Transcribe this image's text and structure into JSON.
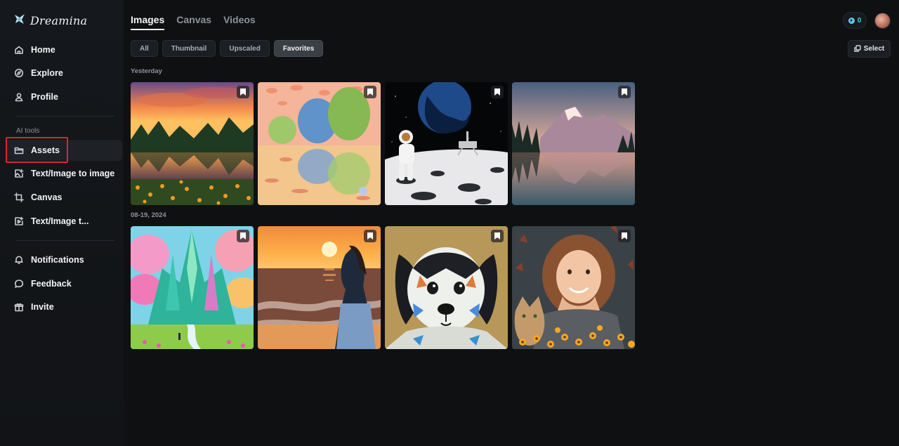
{
  "brand": {
    "name": "Dreamina",
    "logo_icon": "dreamina-logo-icon"
  },
  "sidebar": {
    "main": [
      {
        "label": "Home",
        "icon": "home-icon"
      },
      {
        "label": "Explore",
        "icon": "compass-icon"
      },
      {
        "label": "Profile",
        "icon": "user-icon"
      }
    ],
    "ai_tools_label": "AI tools",
    "tools": [
      {
        "label": "Assets",
        "icon": "folder-icon",
        "active": true
      },
      {
        "label": "Text/Image to image",
        "icon": "image-plus-icon"
      },
      {
        "label": "Canvas",
        "icon": "crop-icon"
      },
      {
        "label": "Text/Image t...",
        "icon": "video-plus-icon"
      }
    ],
    "bottom": [
      {
        "label": "Notifications",
        "icon": "bell-icon"
      },
      {
        "label": "Feedback",
        "icon": "chat-icon"
      },
      {
        "label": "Invite",
        "icon": "gift-icon"
      }
    ]
  },
  "tabs": [
    {
      "label": "Images",
      "active": true
    },
    {
      "label": "Canvas"
    },
    {
      "label": "Videos"
    }
  ],
  "filters": [
    {
      "label": "All"
    },
    {
      "label": "Thumbnail"
    },
    {
      "label": "Upscaled"
    },
    {
      "label": "Favorites",
      "active": true
    }
  ],
  "header_right": {
    "credits": "0",
    "select_label": "Select"
  },
  "groups": [
    {
      "label": "Yesterday",
      "images": [
        {
          "subject": "sunset-lake-flowers"
        },
        {
          "subject": "impressionist-pond"
        },
        {
          "subject": "astronaut-moon"
        },
        {
          "subject": "mountain-lake-reflection"
        }
      ]
    },
    {
      "label": "08-19, 2024",
      "images": [
        {
          "subject": "rainbow-castle"
        },
        {
          "subject": "woman-sunset-beach"
        },
        {
          "subject": "colorful-puppy"
        },
        {
          "subject": "girl-with-cat"
        }
      ]
    }
  ],
  "colors": {
    "background": "#0f1012",
    "highlight": "#d9262f",
    "credit_accent": "#5ec7e8"
  }
}
